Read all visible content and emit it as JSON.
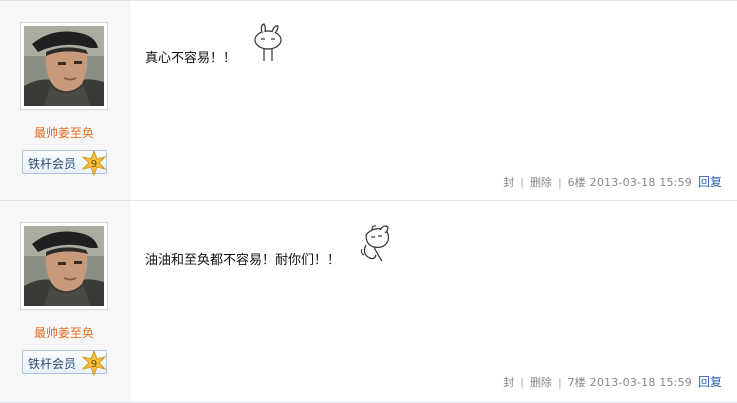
{
  "posts": [
    {
      "username": "最帅姜至奂",
      "badge_label": "铁杆会员",
      "badge_level": "9",
      "content": "真心不容易！！",
      "seal": "封",
      "delete": "删除",
      "floor": "6楼",
      "datetime": "2013-03-18 15:59",
      "reply": "回复",
      "emoji_icon": "rabbit-standing-icon"
    },
    {
      "username": "最帅姜至奂",
      "badge_label": "铁杆会员",
      "badge_level": "9",
      "content": "油油和至奂都不容易！耐你们！！",
      "seal": "封",
      "delete": "删除",
      "floor": "7楼",
      "datetime": "2013-03-18 15:59",
      "reply": "回复",
      "emoji_icon": "rabbit-hugging-icon"
    }
  ],
  "colors": {
    "username": "#e56f26",
    "reply_link": "#2d64b3",
    "badge_border": "#a9c5e3",
    "badge_star": "#f3c33a"
  }
}
